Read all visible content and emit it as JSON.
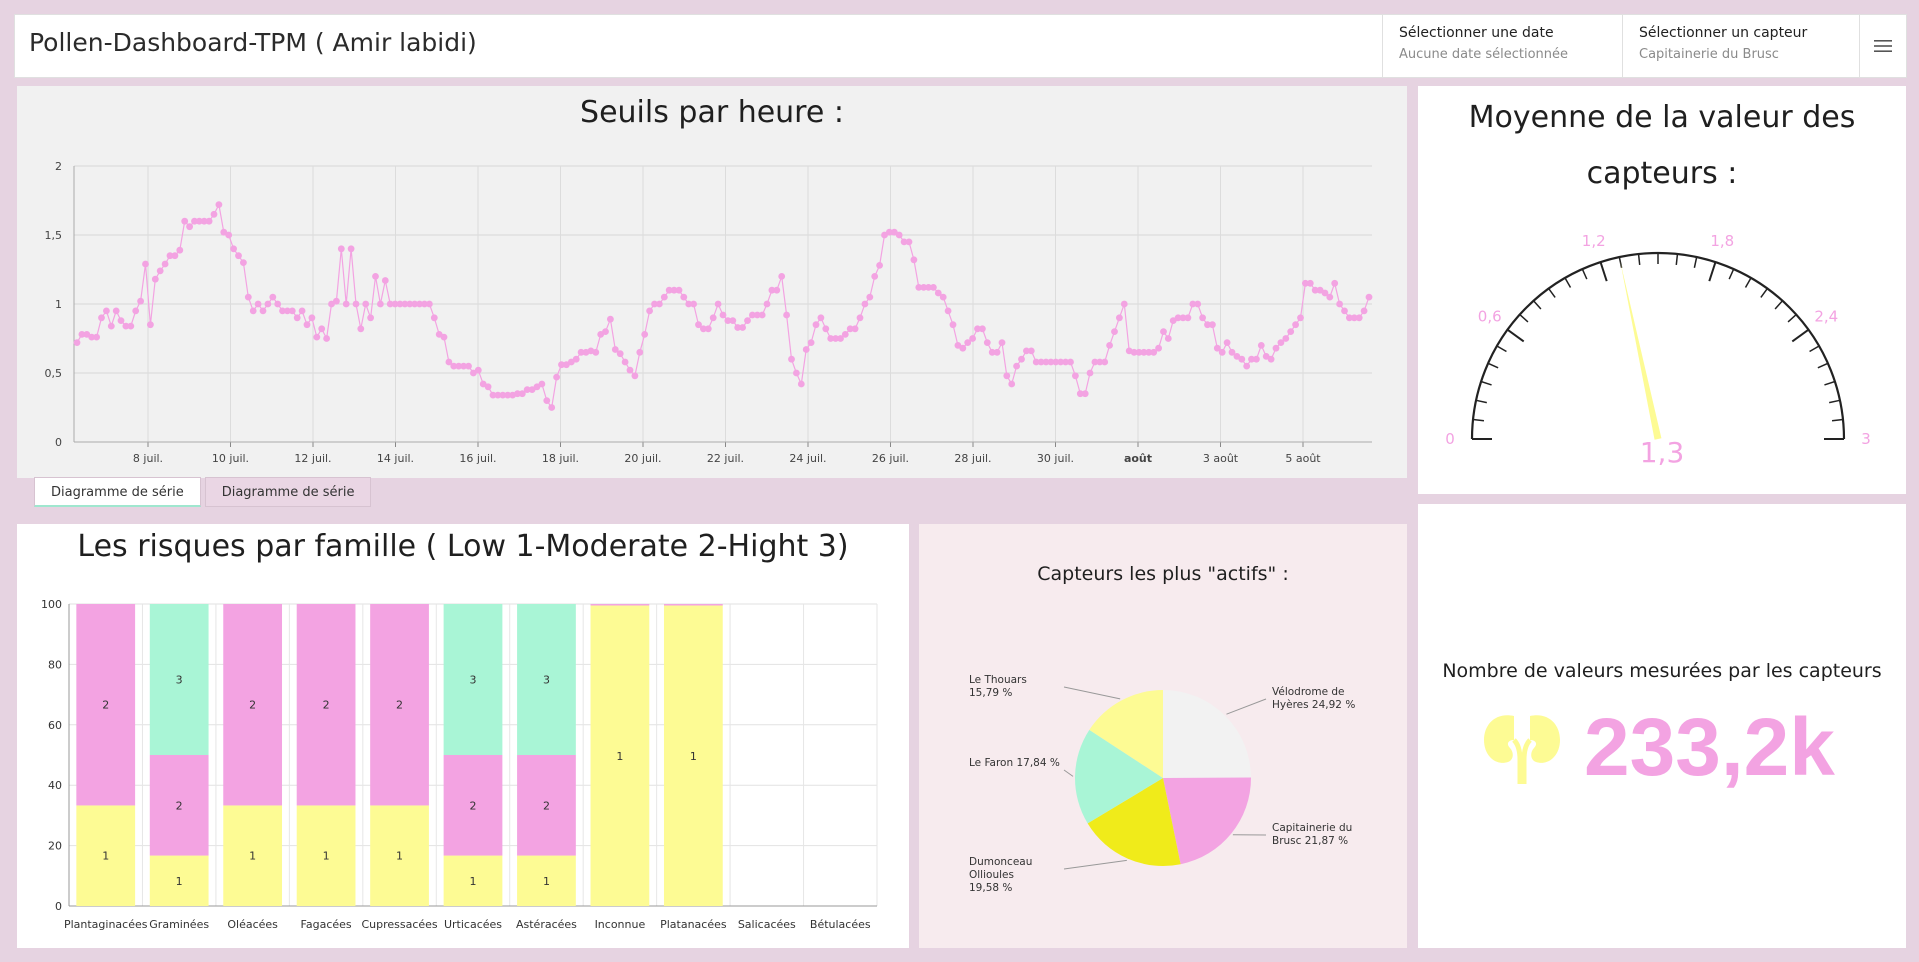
{
  "header": {
    "title": "Pollen-Dashboard-TPM ( Amir labidi)",
    "date_selector": {
      "label": "Sélectionner une date",
      "value": "Aucune date sélectionnée"
    },
    "sensor_selector": {
      "label": "Sélectionner un capteur",
      "value": "Capitainerie du Brusc"
    },
    "menu_icon": "hamburger-icon"
  },
  "colors": {
    "pink": "#f3a3e2",
    "yellow": "#fdfb94",
    "yellow_dark": "#f0eb1a",
    "mint": "#a9f5d6",
    "light_gray": "#f2f2f2",
    "panel_bg": "#f1f1f1",
    "pie_panel_bg": "#f7ebee"
  },
  "series_chart": {
    "title": "Seuils par heure :",
    "tabs": [
      "Diagramme de série",
      "Diagramme de série"
    ],
    "active_tab": 0
  },
  "gauge": {
    "title_line1": "Moyenne de la valeur des",
    "title_line2": "capteurs :",
    "value_label": "1,3",
    "tick_labels": [
      "0",
      "0,6",
      "1,2",
      "1,8",
      "2,4",
      "3"
    ]
  },
  "bar_chart": {
    "title": "Les risques par famille ( Low 1-Moderate 2-Hight 3)"
  },
  "pie_chart": {
    "title": "Capteurs les plus \"actifs\" :"
  },
  "indicator": {
    "title": "Nombre de valeurs mesurées par les capteurs",
    "icon": "kidneys-icon",
    "value": "233,2k"
  },
  "chart_data": [
    {
      "type": "line",
      "title": "Seuils par heure :",
      "x_start": "2023-07-07",
      "x_end": "2023-08-06",
      "x_ticks": [
        "8 juil.",
        "10 juil.",
        "12 juil.",
        "14 juil.",
        "16 juil.",
        "18 juil.",
        "20 juil.",
        "22 juil.",
        "24 juil.",
        "26 juil.",
        "28 juil.",
        "30 juil.",
        "août",
        "3 août",
        "5 août"
      ],
      "y_ticks": [
        "0",
        "0,5",
        "1",
        "1,5",
        "2"
      ],
      "ylim": [
        0,
        2
      ],
      "grid": true,
      "values": [
        0.72,
        0.78,
        0.78,
        0.76,
        0.76,
        0.9,
        0.95,
        0.84,
        0.95,
        0.88,
        0.84,
        0.84,
        0.95,
        1.02,
        1.29,
        0.85,
        1.18,
        1.24,
        1.29,
        1.35,
        1.35,
        1.39,
        1.6,
        1.56,
        1.6,
        1.6,
        1.6,
        1.6,
        1.65,
        1.72,
        1.52,
        1.5,
        1.4,
        1.35,
        1.3,
        1.05,
        0.95,
        1.0,
        0.95,
        1.0,
        1.05,
        1.0,
        0.95,
        0.95,
        0.95,
        0.9,
        0.95,
        0.85,
        0.9,
        0.76,
        0.82,
        0.75,
        1.0,
        1.02,
        1.4,
        1.0,
        1.4,
        1.0,
        0.82,
        1.0,
        0.9,
        1.2,
        1.0,
        1.17,
        1.0,
        1.0,
        1.0,
        1.0,
        1.0,
        1.0,
        1.0,
        1.0,
        1.0,
        0.9,
        0.78,
        0.76,
        0.58,
        0.55,
        0.55,
        0.55,
        0.55,
        0.5,
        0.52,
        0.42,
        0.4,
        0.34,
        0.34,
        0.34,
        0.34,
        0.34,
        0.35,
        0.35,
        0.38,
        0.38,
        0.4,
        0.42,
        0.3,
        0.25,
        0.47,
        0.56,
        0.56,
        0.58,
        0.6,
        0.65,
        0.65,
        0.66,
        0.65,
        0.78,
        0.8,
        0.89,
        0.67,
        0.64,
        0.58,
        0.52,
        0.48,
        0.65,
        0.78,
        0.95,
        1.0,
        1.0,
        1.05,
        1.1,
        1.1,
        1.1,
        1.05,
        1.0,
        1.0,
        0.85,
        0.82,
        0.82,
        0.9,
        1.0,
        0.92,
        0.88,
        0.88,
        0.83,
        0.83,
        0.88,
        0.92,
        0.92,
        0.92,
        1.0,
        1.1,
        1.1,
        1.2,
        0.92,
        0.6,
        0.5,
        0.42,
        0.67,
        0.72,
        0.85,
        0.9,
        0.82,
        0.75,
        0.75,
        0.75,
        0.78,
        0.82,
        0.82,
        0.9,
        1.0,
        1.05,
        1.2,
        1.28,
        1.5,
        1.52,
        1.52,
        1.5,
        1.45,
        1.45,
        1.32,
        1.12,
        1.12,
        1.12,
        1.12,
        1.08,
        1.05,
        0.95,
        0.85,
        0.7,
        0.68,
        0.72,
        0.75,
        0.82,
        0.82,
        0.72,
        0.65,
        0.65,
        0.72,
        0.48,
        0.42,
        0.55,
        0.6,
        0.66,
        0.66,
        0.58,
        0.58,
        0.58,
        0.58,
        0.58,
        0.58,
        0.58,
        0.58,
        0.48,
        0.35,
        0.35,
        0.5,
        0.58,
        0.58,
        0.58,
        0.7,
        0.8,
        0.9,
        1.0,
        0.66,
        0.65,
        0.65,
        0.65,
        0.65,
        0.65,
        0.68,
        0.8,
        0.75,
        0.88,
        0.9,
        0.9,
        0.9,
        1.0,
        1.0,
        0.9,
        0.85,
        0.85,
        0.68,
        0.65,
        0.72,
        0.65,
        0.62,
        0.6,
        0.55,
        0.6,
        0.6,
        0.7,
        0.62,
        0.6,
        0.68,
        0.72,
        0.75,
        0.8,
        0.85,
        0.9,
        1.15,
        1.15,
        1.1,
        1.1,
        1.08,
        1.05,
        1.15,
        1.0,
        0.95,
        0.9,
        0.9,
        0.9,
        0.95,
        1.05
      ]
    },
    {
      "type": "bar",
      "title": "Les risques par famille ( Low 1-Moderate 2-Hight 3)",
      "stacked": true,
      "ylim": [
        0,
        100
      ],
      "y_ticks": [
        "0",
        "20",
        "40",
        "60",
        "80",
        "100"
      ],
      "categories": [
        "Plantaginacées",
        "Graminées",
        "Oléacées",
        "Fagacées",
        "Cupressacées",
        "Urticacées",
        "Astéracées",
        "Inconnue",
        "Platanacées",
        "Salicacées",
        "Bétulacées"
      ],
      "series": [
        {
          "name": "1",
          "color": "#fdfb94",
          "values": [
            33.3,
            16.7,
            33.3,
            33.3,
            33.3,
            16.7,
            16.7,
            99.5,
            99.5,
            0,
            0
          ]
        },
        {
          "name": "2",
          "color": "#f3a3e2",
          "values": [
            66.7,
            33.3,
            66.7,
            66.7,
            66.7,
            33.3,
            33.3,
            0.5,
            0.5,
            0,
            0
          ]
        },
        {
          "name": "3",
          "color": "#a9f5d6",
          "values": [
            0,
            50,
            0,
            0,
            0,
            50,
            50,
            0,
            0,
            0,
            0
          ]
        }
      ],
      "segment_labels": [
        [
          "1",
          "2",
          ""
        ],
        [
          "1",
          "2",
          "3"
        ],
        [
          "1",
          "2",
          ""
        ],
        [
          "1",
          "2",
          ""
        ],
        [
          "1",
          "2",
          ""
        ],
        [
          "1",
          "2",
          "3"
        ],
        [
          "1",
          "2",
          "3"
        ],
        [
          "1",
          "",
          ""
        ],
        [
          "1",
          "",
          ""
        ],
        [
          "",
          "",
          ""
        ],
        [
          "",
          "",
          ""
        ]
      ]
    },
    {
      "type": "pie",
      "title": "Capteurs les plus \"actifs\" :",
      "slices": [
        {
          "label_lines": [
            "Vélodrome de",
            "Hyères 24,92 %"
          ],
          "value": 24.92,
          "color": "#f2f2f2"
        },
        {
          "label_lines": [
            "Capitainerie du",
            "Brusc 21,87 %"
          ],
          "value": 21.87,
          "color": "#f3a3e2"
        },
        {
          "label_lines": [
            "Dumonceau",
            "Ollioules",
            "19,58 %"
          ],
          "value": 19.58,
          "color": "#f0eb1a"
        },
        {
          "label_lines": [
            "Le Faron 17,84 %"
          ],
          "value": 17.84,
          "color": "#a9f5d6"
        },
        {
          "label_lines": [
            "Le Thouars",
            "15,79 %"
          ],
          "value": 15.79,
          "color": "#fdfb94"
        }
      ]
    },
    {
      "type": "gauge",
      "min": 0,
      "max": 3,
      "value": 1.3,
      "tick_labels": [
        "0",
        "0,6",
        "1,2",
        "1,8",
        "2,4",
        "3"
      ]
    }
  ]
}
